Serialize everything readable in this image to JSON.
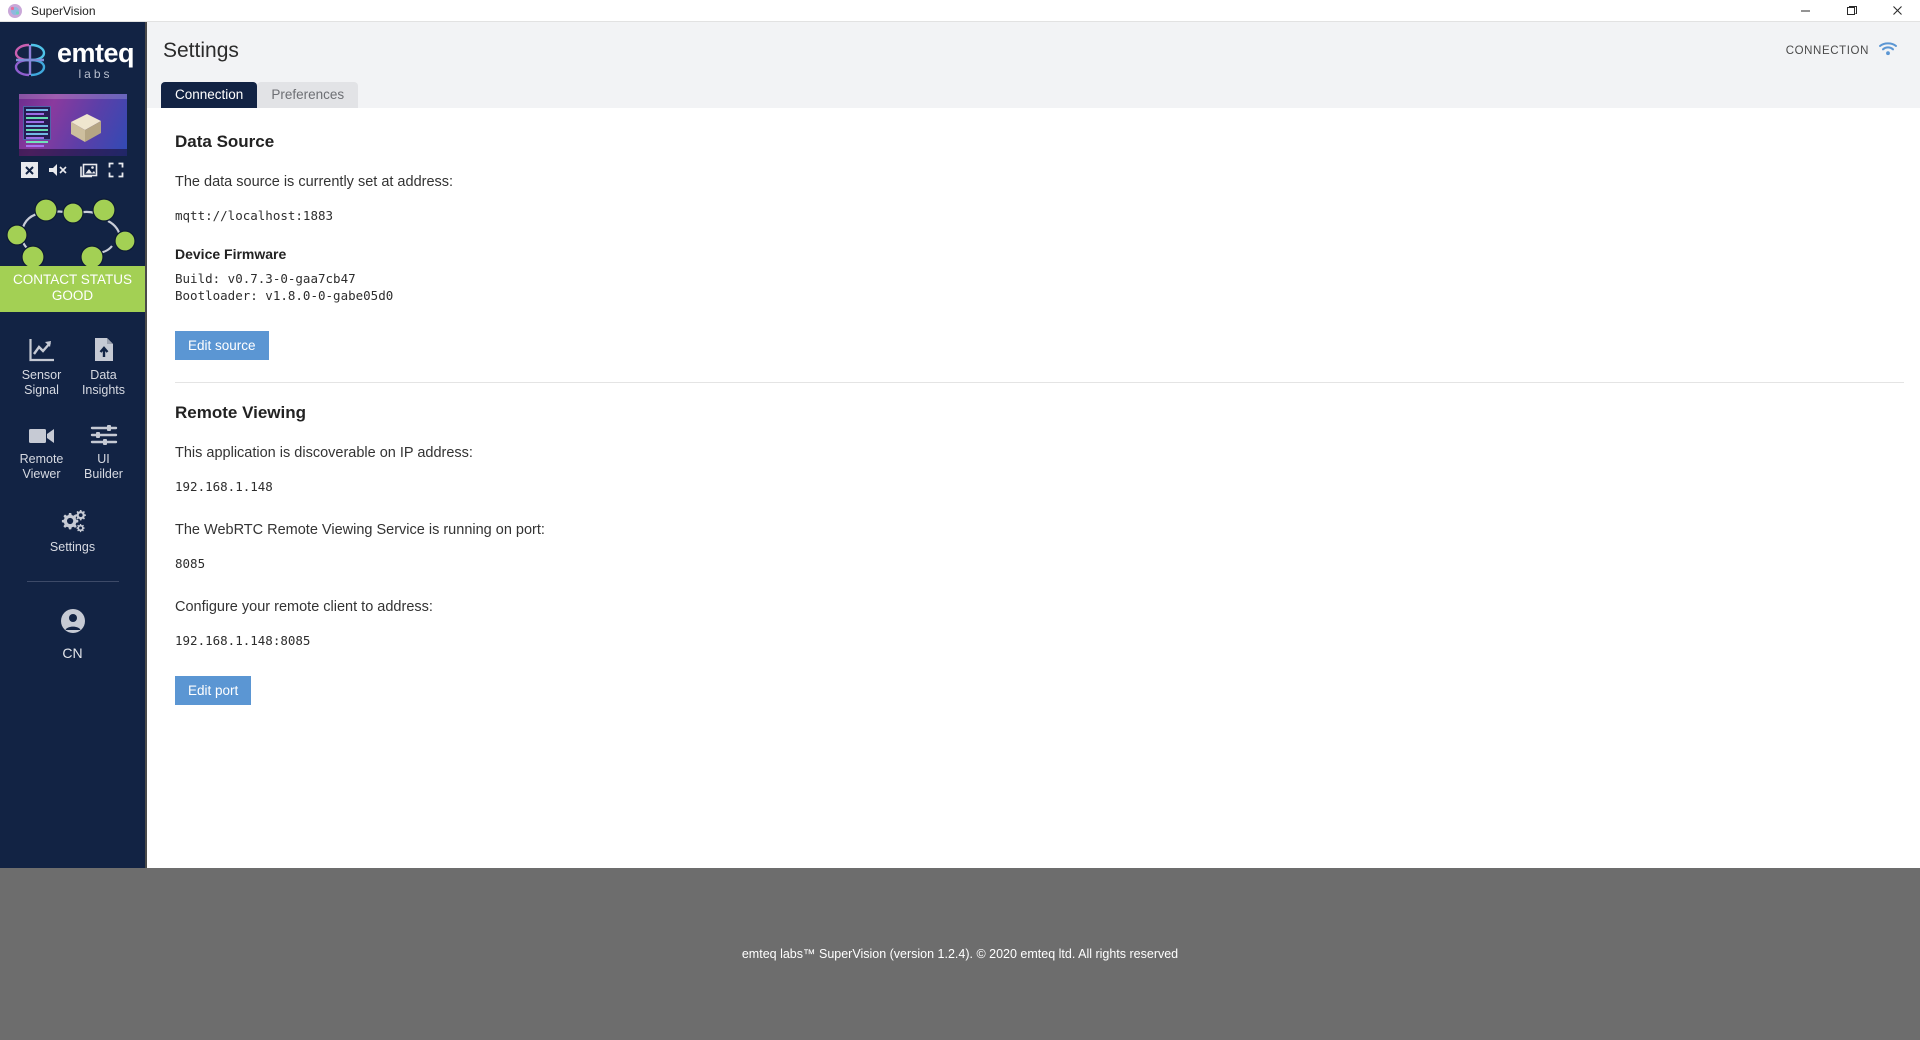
{
  "window": {
    "title": "SuperVision",
    "icon": "app-icon",
    "minimize": "─",
    "maximize": "❐",
    "close": "✕"
  },
  "sidebar": {
    "logo": {
      "name": "emteq",
      "sub": "labs"
    },
    "preview": {
      "tools": [
        {
          "name": "close-preview-icon",
          "glyph": "✖"
        },
        {
          "name": "mute-icon",
          "glyph": ""
        },
        {
          "name": "snapshot-icon",
          "glyph": ""
        },
        {
          "name": "fullscreen-icon",
          "glyph": ""
        }
      ]
    },
    "contact_map": {
      "name": "contact-status-map",
      "node_color": "#a3d054",
      "node_count": 8
    },
    "status": {
      "line1": "CONTACT STATUS",
      "line2": "GOOD",
      "color": "#a3d054"
    },
    "nav": [
      {
        "icon": "sensor-signal-icon",
        "label": "Sensor\nSignal",
        "l1": "Sensor",
        "l2": "Signal"
      },
      {
        "icon": "data-insights-icon",
        "label": "Data\nInsights",
        "l1": "Data",
        "l2": "Insights"
      },
      {
        "icon": "remote-viewer-icon",
        "label": "Remote\nViewer",
        "l1": "Remote",
        "l2": "Viewer"
      },
      {
        "icon": "ui-builder-icon",
        "label": "UI\nBuilder",
        "l1": "UI",
        "l2": "Builder"
      },
      {
        "icon": "settings-icon",
        "label": "Settings",
        "l1": "Settings",
        "l2": ""
      }
    ],
    "profile": {
      "icon": "avatar-icon",
      "initials": "CN"
    }
  },
  "header": {
    "title": "Settings",
    "connection_label": "CONNECTION",
    "wifi_icon": "wifi-icon",
    "wifi_color": "#5b96d3"
  },
  "tabs": [
    {
      "label": "Connection",
      "active": true
    },
    {
      "label": "Preferences",
      "active": false
    }
  ],
  "data_source": {
    "title": "Data Source",
    "description": "The data source is currently set at address:",
    "address": "mqtt://localhost:1883",
    "firmware_title": "Device Firmware",
    "build": "Build: v0.7.3-0-gaa7cb47",
    "bootloader": "Bootloader: v1.8.0-0-gabe05d0",
    "edit_button": "Edit source"
  },
  "remote_viewing": {
    "title": "Remote Viewing",
    "ip_description": "This application is discoverable on IP address:",
    "ip_address": "192.168.1.148",
    "port_description": "The WebRTC Remote Viewing Service is running on port:",
    "port": "8085",
    "client_description": "Configure your remote client to address:",
    "client_address": "192.168.1.148:8085",
    "edit_button": "Edit port"
  },
  "footer": {
    "text": "emteq labs™ SuperVision (version 1.2.4). © 2020 emteq ltd. All rights reserved"
  }
}
